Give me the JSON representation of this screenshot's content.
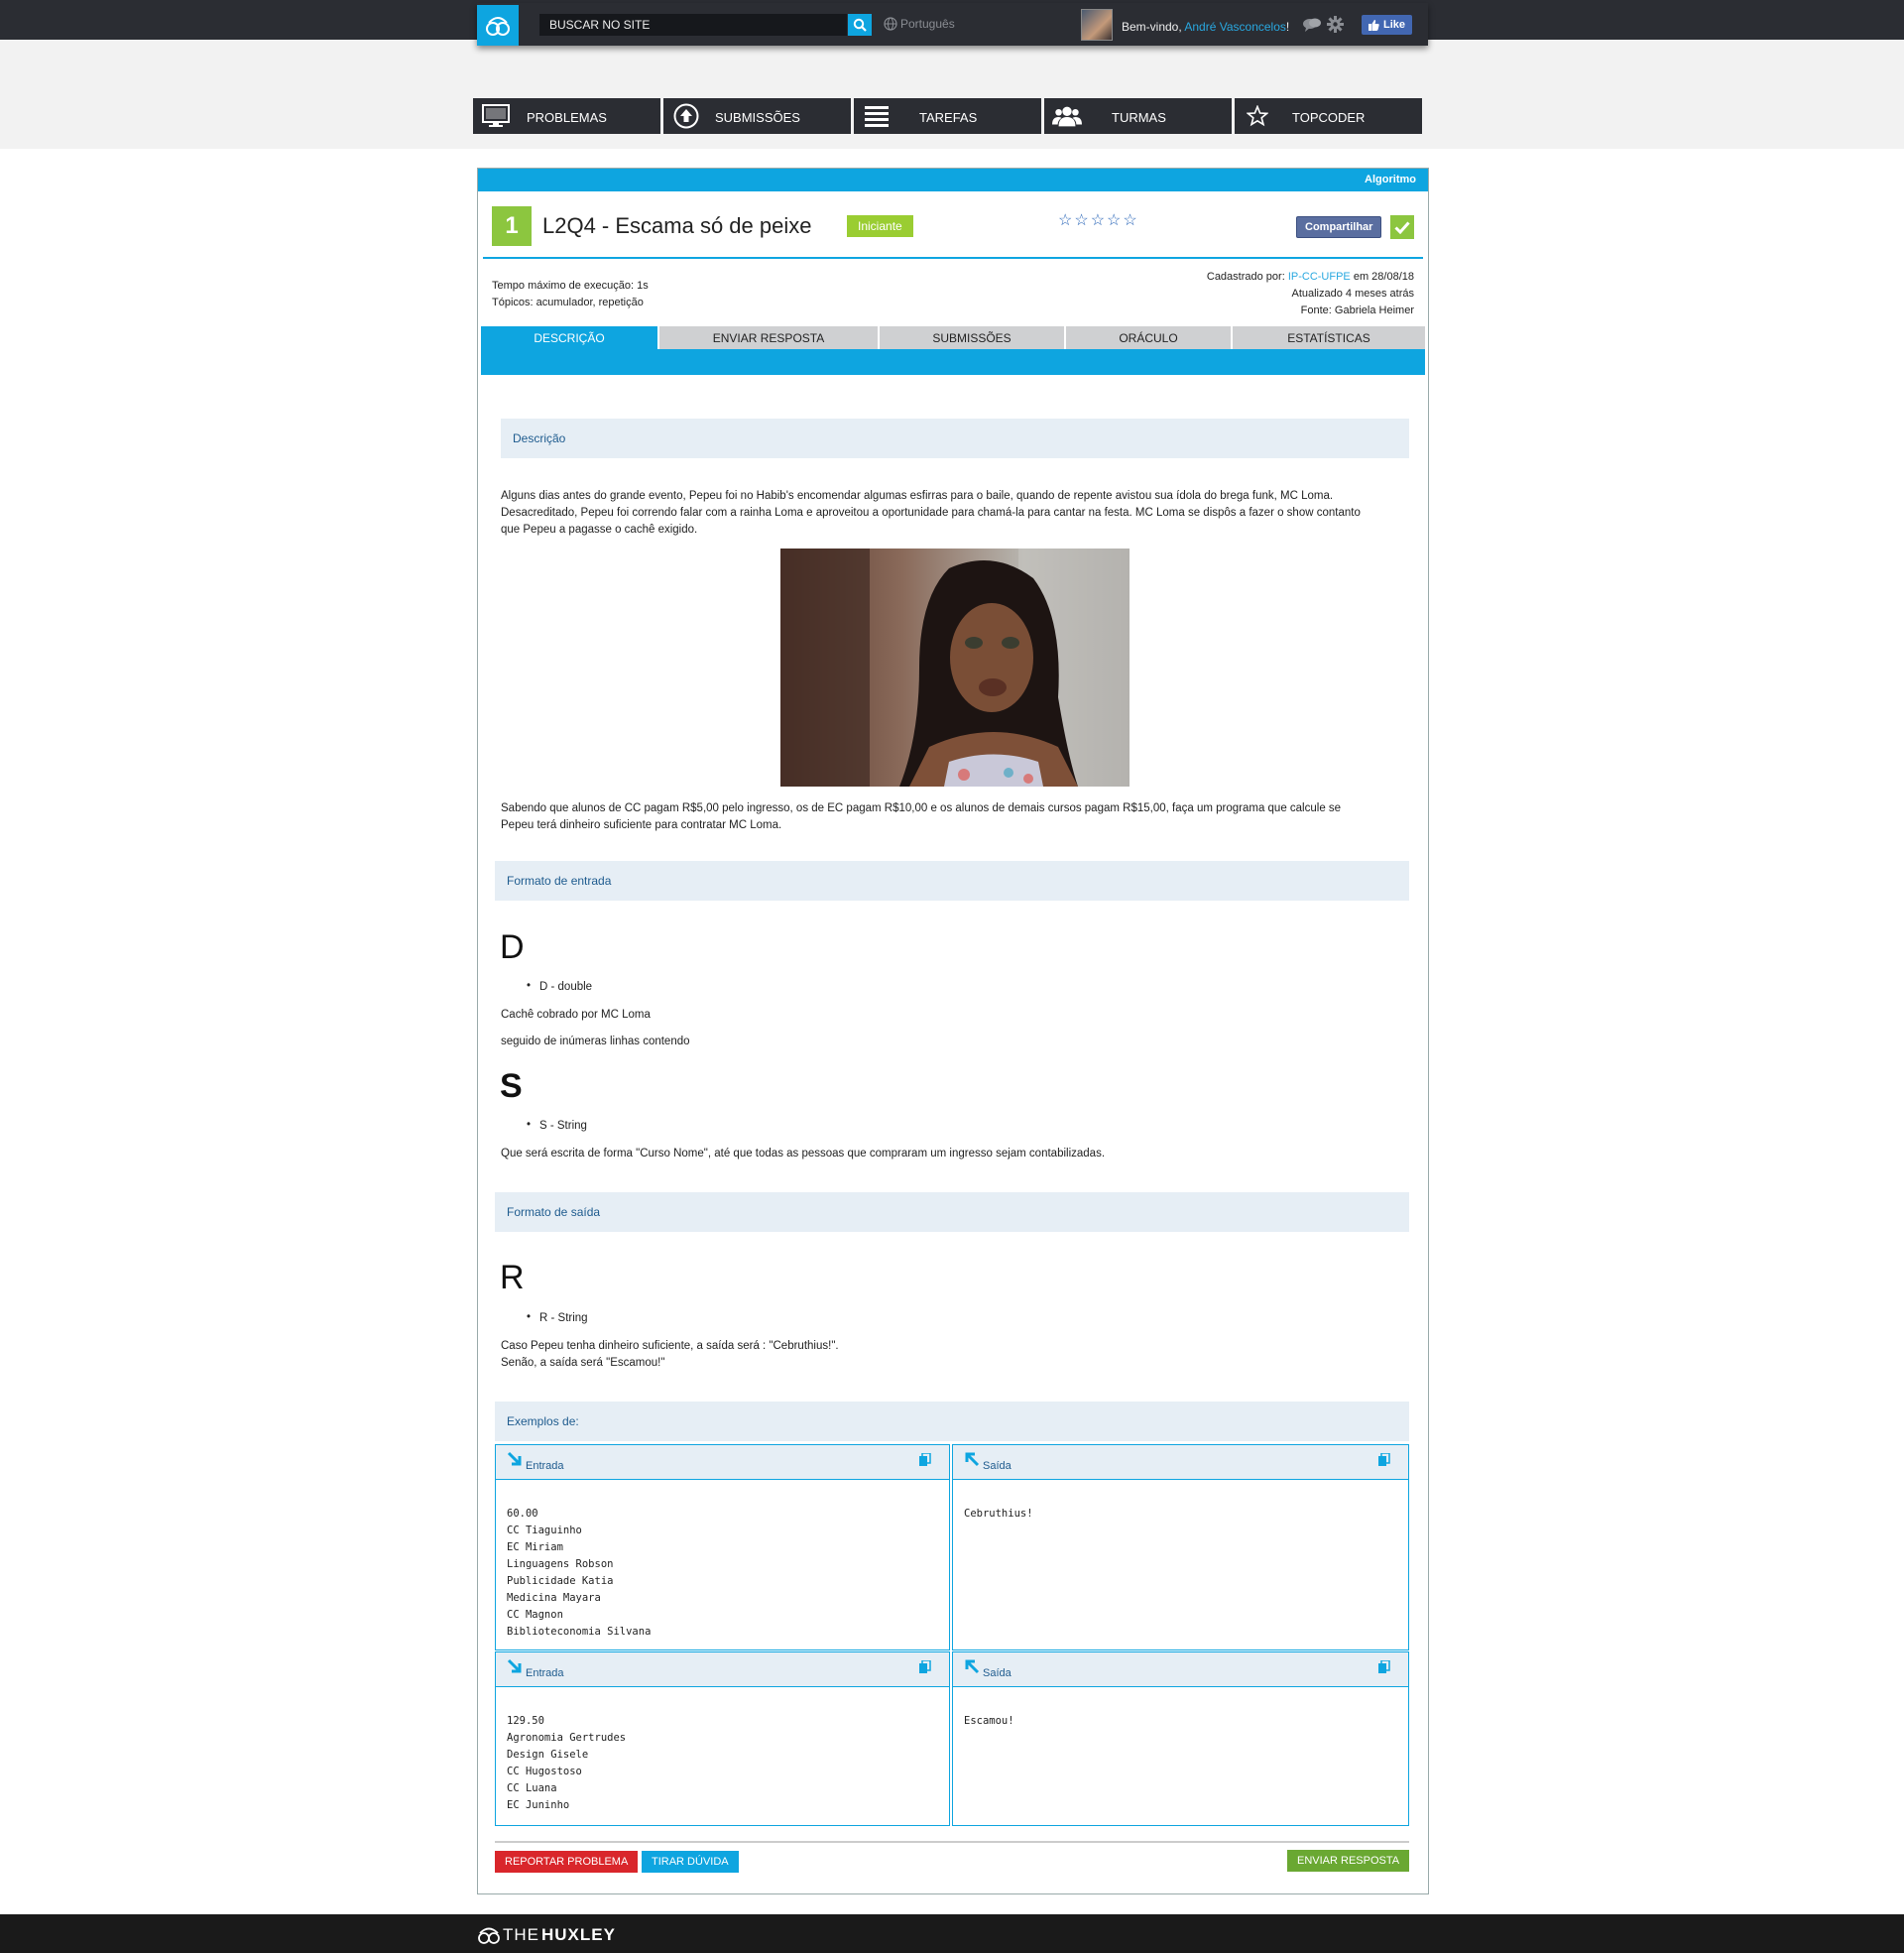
{
  "header": {
    "search_placeholder": "BUSCAR NO SITE",
    "language": "Português",
    "welcome_prefix": "Bem-vindo,",
    "user_name": "André Vasconcelos",
    "welcome_suffix": "!",
    "like_label": "Like"
  },
  "nav": {
    "items": [
      {
        "label": "PROBLEMAS",
        "icon": "monitor-icon"
      },
      {
        "label": "SUBMISSÕES",
        "icon": "upload-icon"
      },
      {
        "label": "TAREFAS",
        "icon": "list-icon"
      },
      {
        "label": "TURMAS",
        "icon": "users-icon"
      },
      {
        "label": "TOPCODER",
        "icon": "star-icon"
      }
    ]
  },
  "problem": {
    "category": "Algoritmo",
    "level_number": "1",
    "title": "L2Q4 - Escama só de peixe",
    "level_tag": "Iniciante",
    "stars": "☆☆☆☆☆",
    "share_label": "Compartilhar",
    "time_limit": "Tempo máximo de execução: 1s",
    "topics": "Tópicos: acumulador, repetição",
    "registered_prefix": "Cadastrado por:",
    "registered_by": "IP-CC-UFPE",
    "registered_date": "em 28/08/18",
    "updated": "Atualizado 4 meses atrás",
    "source": "Fonte: Gabriela Heimer"
  },
  "tabs": [
    "DESCRIÇÃO",
    "ENVIAR RESPOSTA",
    "SUBMISSÕES",
    "ORÁCULO",
    "ESTATÍSTICAS"
  ],
  "description": {
    "heading": "Descrição",
    "para1_line1": "Alguns dias antes do grande evento, Pepeu foi no Habib's encomendar algumas esfirras para o baile, quando de repente avistou sua ídola do brega funk, MC Loma.",
    "para1_line2": "Desacreditado, Pepeu foi correndo falar com a rainha Loma e aproveitou a oportunidade para chamá-la para cantar na festa. MC Loma se dispôs a fazer o show contanto",
    "para1_line3": "que Pepeu a pagasse o cachê exigido.",
    "para2_line1": "Sabendo que alunos de CC pagam R$5,00 pelo ingresso, os de EC pagam R$10,00 e os alunos de demais cursos pagam R$15,00, faça um programa que calcule se",
    "para2_line2": "Pepeu terá dinheiro suficiente para contratar MC Loma."
  },
  "input_format": {
    "heading": "Formato de entrada",
    "letter1": "D",
    "bullet1": "D - double",
    "text1": "Cachê cobrado por MC Loma",
    "text2": "seguido de inúmeras linhas contendo",
    "letter2": "S",
    "bullet2": "S - String",
    "text3": "Que será escrita de forma \"Curso Nome\", até que todas as pessoas que compraram um ingresso sejam contabilizadas."
  },
  "output_format": {
    "heading": "Formato de saída",
    "letter": "R",
    "bullet": "R - String",
    "text1": "Caso Pepeu tenha dinheiro suficiente, a saída será : \"Cebruthius!\".",
    "text2": "Senão, a saída será \"Escamou!\""
  },
  "examples": {
    "heading": "Exemplos de:",
    "input_label": "Entrada",
    "output_label": "Saída",
    "ex1_input": "60.00\nCC Tiaguinho\nEC Miriam\nLinguagens Robson\nPublicidade Katia\nMedicina Mayara\nCC Magnon\nBiblioteconomia Silvana",
    "ex1_output": "Cebruthius!",
    "ex2_input": "129.50\nAgronomia Gertrudes\nDesign Gisele\nCC Hugostoso\nCC Luana\nEC Juninho",
    "ex2_output": "Escamou!"
  },
  "footer_buttons": {
    "report": "REPORTAR PROBLEMA",
    "doubt": "TIRAR DÚVIDA",
    "submit": "ENVIAR RESPOSTA"
  },
  "footer": {
    "brand_light": "THE",
    "brand_bold": "HUXLEY"
  },
  "colors": {
    "accent": "#0ea5e0",
    "dark": "#2b2d33",
    "green": "#8cc63f",
    "red": "#d9262b",
    "section_bg": "#e6eef5"
  }
}
